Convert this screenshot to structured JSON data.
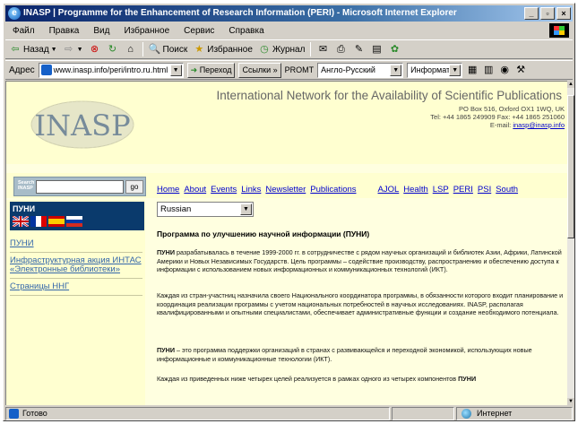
{
  "window": {
    "title": "INASP | Programme for the Enhancement of Research Information (PERI) - Microsoft Internet Explorer",
    "controls": [
      "_",
      "▫",
      "×"
    ]
  },
  "menu": [
    "Файл",
    "Правка",
    "Вид",
    "Избранное",
    "Сервис",
    "Справка"
  ],
  "toolbar": {
    "back": "Назад",
    "search": "Поиск",
    "favorites": "Избранное",
    "journal": "Журнал"
  },
  "addressbar": {
    "label": "Адрес",
    "url": "www.inasp.info/peri/intro.ru.html",
    "go": "Переход",
    "links": "Ссылки",
    "promt": "PROMT",
    "promt_select": "Англо-Русский",
    "info_select": "Информатик"
  },
  "page": {
    "logo_text": "INASP",
    "org_title": "International Network for the Availability of Scientific Publications",
    "address_line1": "PO Box 516, Oxford OX1 1WQ, UK",
    "address_line2": "Tel: +44 1865 249909 Fax: +44 1865 251060",
    "email_label": "E-mail:",
    "email": "inasp@inasp.info",
    "search_label": "Search INASP",
    "search_go": "go",
    "nav": [
      "Home",
      "About",
      "Events",
      "Links",
      "Newsletter",
      "Publications",
      "AJOL",
      "Health",
      "LSP",
      "PERI",
      "PSI",
      "South"
    ],
    "lang_box_title": "ПУНИ",
    "side_links": [
      "ПУНИ",
      "Инфраструктурная акция ИНТАС «Электронные библиотеки»",
      "Страницы ННГ"
    ],
    "lang_select": "Russian",
    "main_title": "Программа по улучшению научной информации (ПУНИ)",
    "p1_bold": "ПУНИ",
    "p1": " разрабатывалась в течение 1999-2000 гг. в сотрудничестве с рядом научных организаций и библиотек Азии, Африки, Латинской Америки и Новых Независимых Государств. Цель программы – содействие производству, распространению и обеспечению доступа к информации с использованием новых информационных и коммуникационных технологий (ИКТ).",
    "p2": "Каждая из стран-участниц назначила своего Национального координатора программы, в обязанности которого входит планирование и координация реализации программы с учетом национальных потребностей в научных исследованиях. INASP, располагая квалифицированными и опытными специалистами, обеспечивает административные функции и создание необходимого потенциала.",
    "p3_bold": "ПУНИ",
    "p3": " – это программа поддержки организаций в странах с развивающейся и переходной экономикой, использующих новые информационные и коммуникационные технологии (ИКТ).",
    "p4": "Каждая из приведенных ниже четырех целей реализуется в рамках одного из четырех компонентов",
    "p4_bold": "ПУНИ"
  },
  "status": {
    "text": "Готово",
    "zone": "Интернет"
  }
}
